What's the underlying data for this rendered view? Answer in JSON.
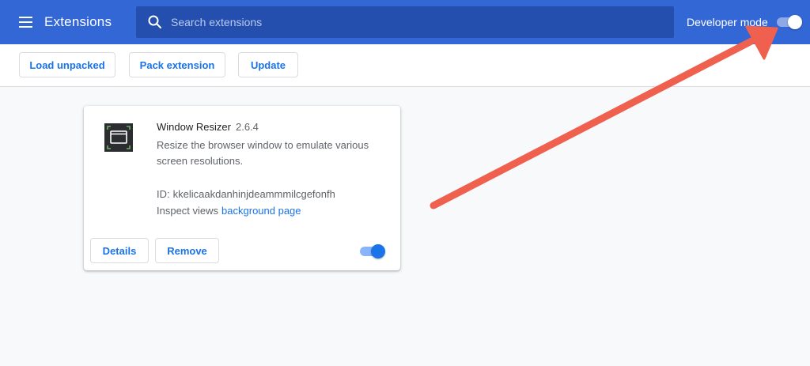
{
  "header": {
    "title": "Extensions",
    "search_placeholder": "Search extensions",
    "developer_mode_label": "Developer mode",
    "developer_mode_on": true,
    "bar_color": "#3367d6"
  },
  "toolbar": {
    "load_unpacked": "Load unpacked",
    "pack_extension": "Pack extension",
    "update": "Update"
  },
  "extension": {
    "name": "Window Resizer",
    "version": "2.6.4",
    "description": "Resize the browser window to emulate various screen resolutions.",
    "id_label": "ID:",
    "id_value": "kkelicaakdanhinjdeammmilcgefonfh",
    "inspect_label": "Inspect views",
    "inspect_link": "background page",
    "details_button": "Details",
    "remove_button": "Remove",
    "enabled": true,
    "icon": "window-resizer-icon"
  },
  "annotation": {
    "color": "#f0604f",
    "points_to": "developer-mode-toggle"
  },
  "accent_color": "#1a73e8"
}
